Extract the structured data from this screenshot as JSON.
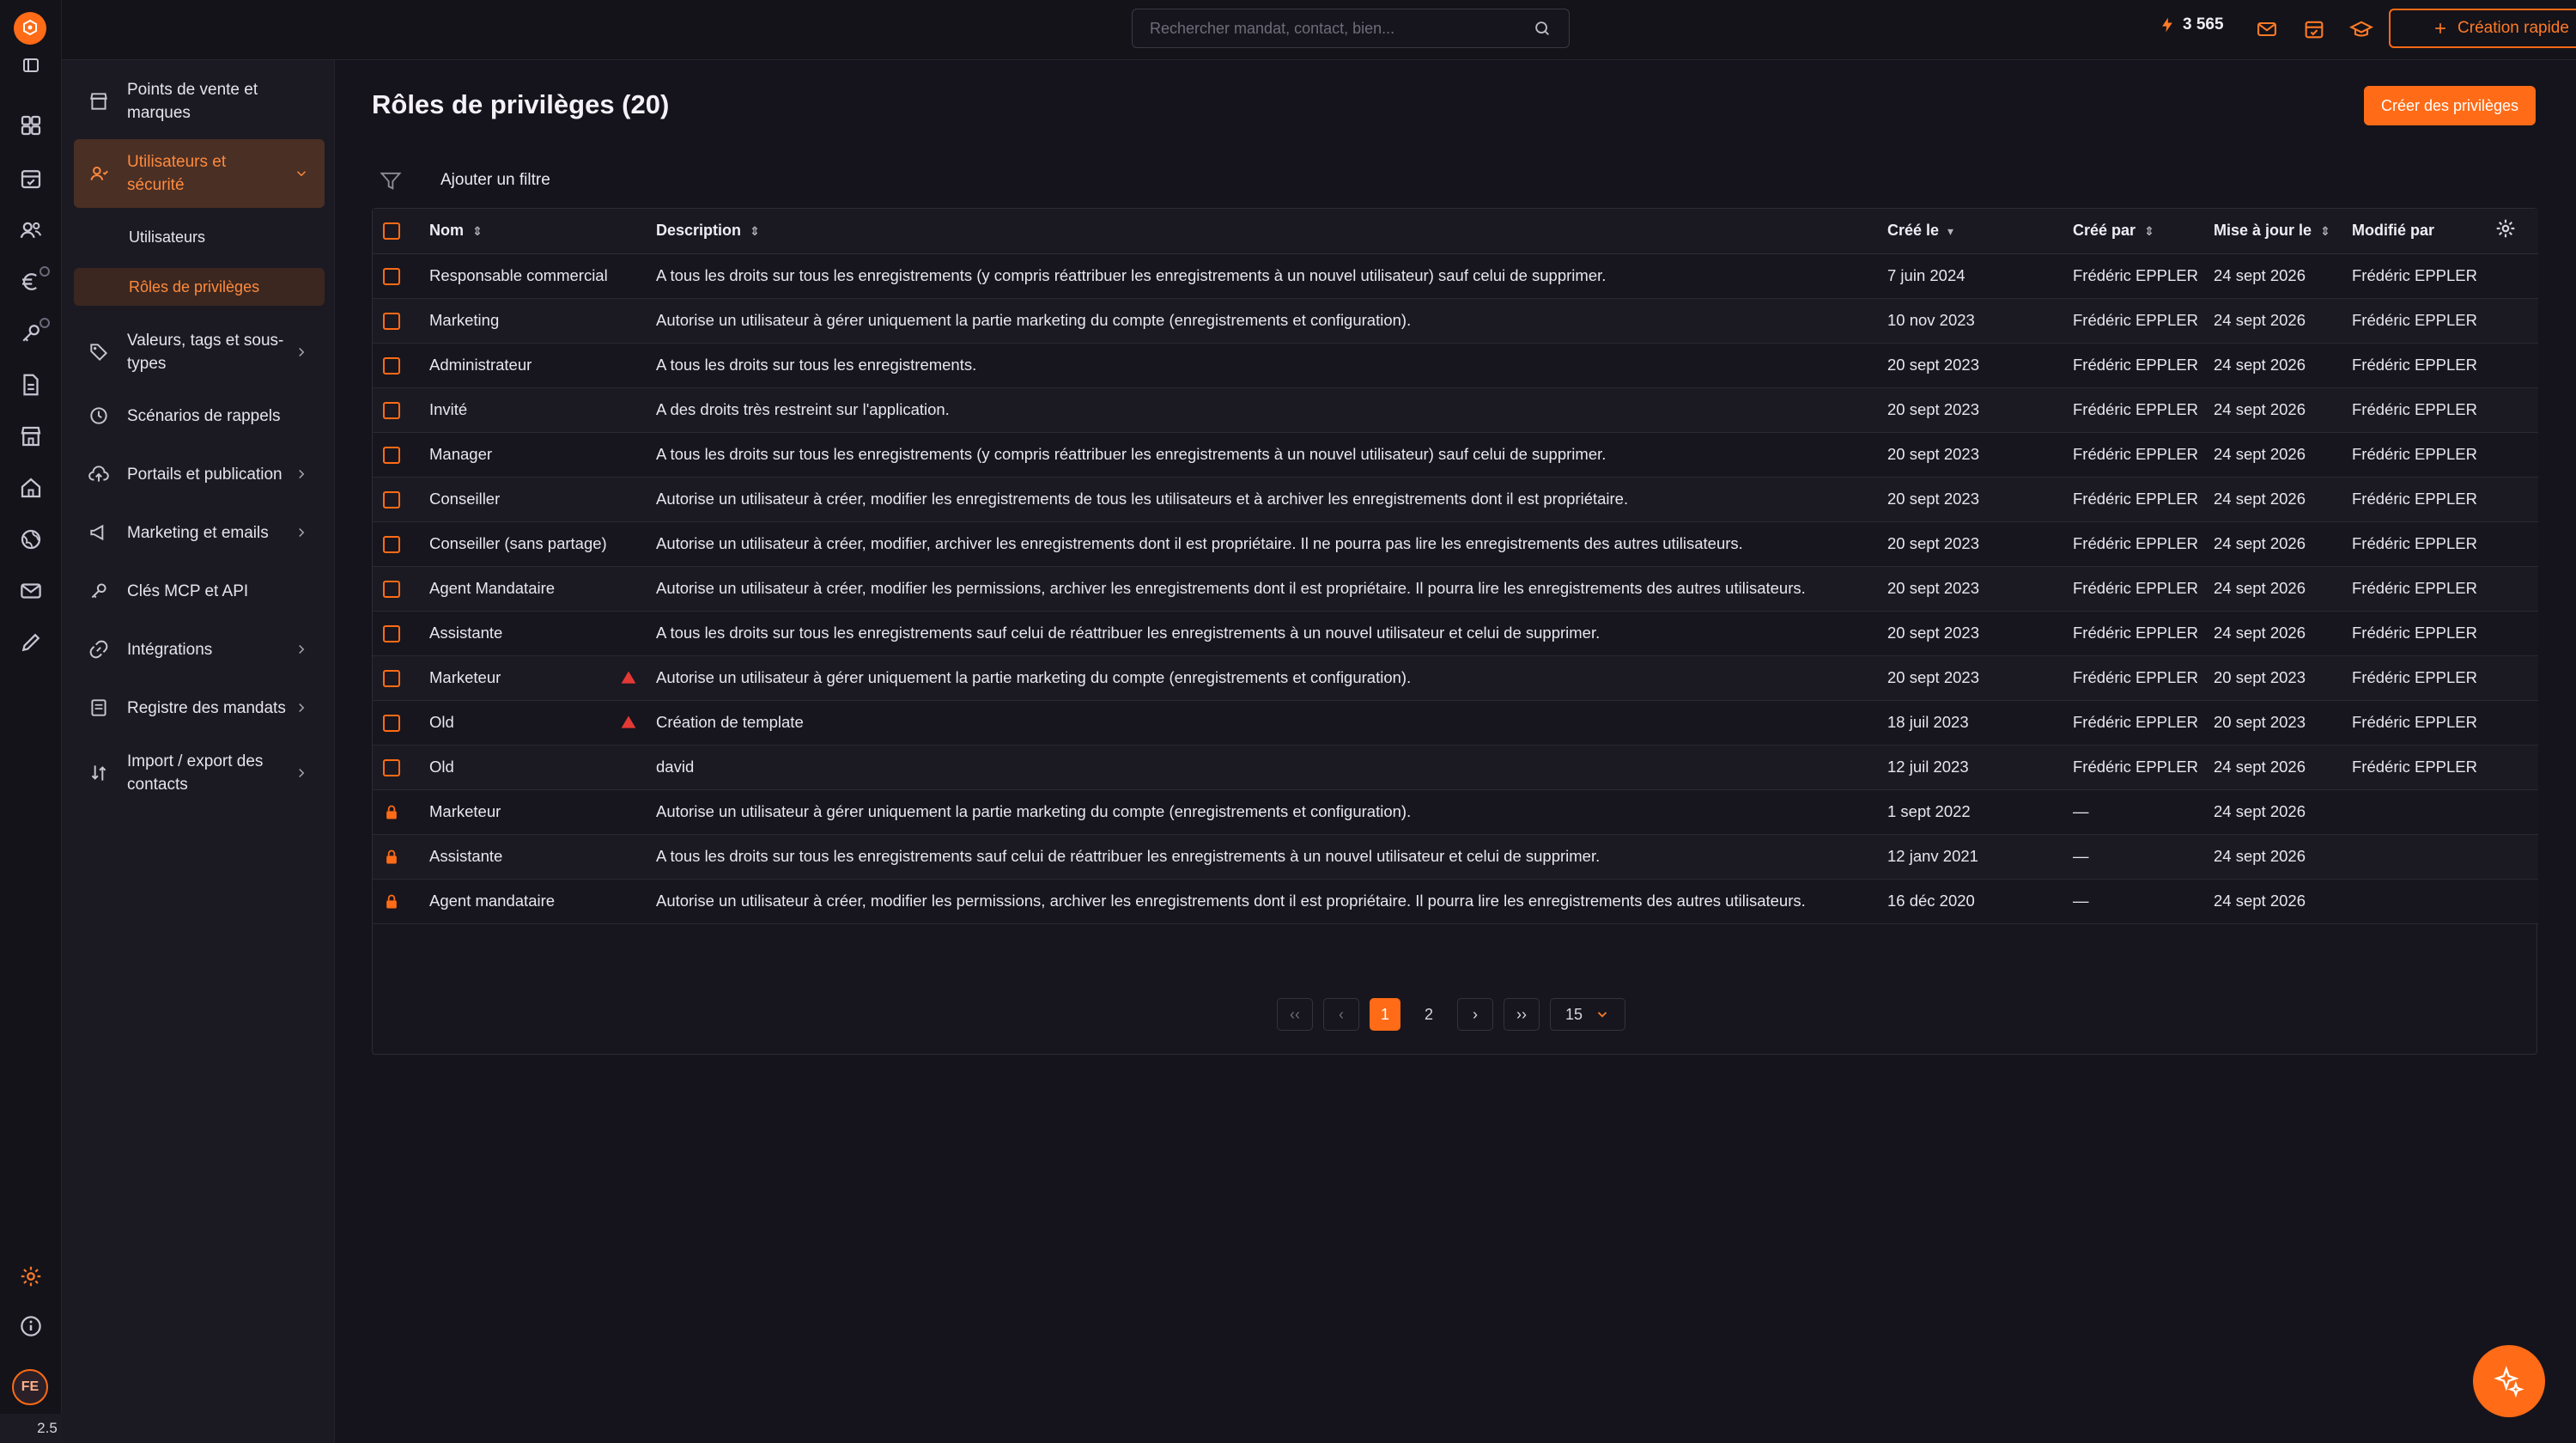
{
  "topbar": {
    "search_placeholder": "Rechercher mandat, contact, bien...",
    "credits": "3 565",
    "quick_create_label": "Création rapide"
  },
  "rail": {
    "version": "2.5",
    "avatar_initials": "FE"
  },
  "sidebar": {
    "items": [
      {
        "label": "Points de vente et marques",
        "icon": "store-icon"
      },
      {
        "label": "Utilisateurs et sécurité",
        "icon": "users-icon"
      },
      {
        "label": "Valeurs, tags et sous-types",
        "icon": "tag-icon"
      },
      {
        "label": "Scénarios de rappels",
        "icon": "clock-icon"
      },
      {
        "label": "Portails et publication",
        "icon": "cloud-upload-icon"
      },
      {
        "label": "Marketing et emails",
        "icon": "megaphone-icon"
      },
      {
        "label": "Clés MCP et API",
        "icon": "key-icon"
      },
      {
        "label": "Intégrations",
        "icon": "link-icon"
      },
      {
        "label": "Registre des mandats",
        "icon": "register-icon"
      },
      {
        "label": "Import / export des contacts",
        "icon": "import-export-icon"
      }
    ],
    "subitems": [
      {
        "label": "Utilisateurs"
      },
      {
        "label": "Rôles de privilèges"
      }
    ]
  },
  "main": {
    "title": "Rôles de privilèges (20)",
    "create_button": "Créer des privilèges",
    "filter_label": "Ajouter un filtre"
  },
  "table": {
    "columns": {
      "name": "Nom",
      "description": "Description",
      "created_on": "Créé le",
      "created_by": "Créé par",
      "updated_on": "Mise à jour le",
      "modified_by": "Modifié par"
    },
    "rows": [
      {
        "name": "Responsable commercial",
        "description": "A tous les droits sur tous les enregistrements (y compris réattribuer les enregistrements à un nouvel utilisateur) sauf celui de supprimer.",
        "created_on": "7 juin 2024",
        "created_by": "Frédéric EPPLER",
        "updated_on": "24 sept 2026",
        "modified_by": "Frédéric EPPLER"
      },
      {
        "name": "Marketing",
        "description": "Autorise un utilisateur à gérer uniquement la partie marketing du compte (enregistrements et configuration).",
        "created_on": "10 nov 2023",
        "created_by": "Frédéric EPPLER",
        "updated_on": "24 sept 2026",
        "modified_by": "Frédéric EPPLER"
      },
      {
        "name": "Administrateur",
        "description": "A tous les droits sur tous les enregistrements.",
        "created_on": "20 sept 2023",
        "created_by": "Frédéric EPPLER",
        "updated_on": "24 sept 2026",
        "modified_by": "Frédéric EPPLER"
      },
      {
        "name": "Invité",
        "description": "A des droits très restreint sur l'application.",
        "created_on": "20 sept 2023",
        "created_by": "Frédéric EPPLER",
        "updated_on": "24 sept 2026",
        "modified_by": "Frédéric EPPLER"
      },
      {
        "name": "Manager",
        "description": "A tous les droits sur tous les enregistrements (y compris réattribuer les enregistrements à un nouvel utilisateur) sauf celui de supprimer.",
        "created_on": "20 sept 2023",
        "created_by": "Frédéric EPPLER",
        "updated_on": "24 sept 2026",
        "modified_by": "Frédéric EPPLER"
      },
      {
        "name": "Conseiller",
        "description": "Autorise un utilisateur à créer, modifier les enregistrements de tous les utilisateurs et à archiver les enregistrements dont il est propriétaire.",
        "created_on": "20 sept 2023",
        "created_by": "Frédéric EPPLER",
        "updated_on": "24 sept 2026",
        "modified_by": "Frédéric EPPLER"
      },
      {
        "name": "Conseiller (sans partage)",
        "description": "Autorise un utilisateur à créer, modifier, archiver les enregistrements dont il est propriétaire. Il ne pourra pas lire les enregistrements des autres utilisateurs.",
        "created_on": "20 sept 2023",
        "created_by": "Frédéric EPPLER",
        "updated_on": "24 sept 2026",
        "modified_by": "Frédéric EPPLER"
      },
      {
        "name": "Agent Mandataire",
        "description": "Autorise un utilisateur à créer, modifier les permissions, archiver les enregistrements dont il est propriétaire. Il pourra lire les enregistrements des autres utilisateurs.",
        "created_on": "20 sept 2023",
        "created_by": "Frédéric EPPLER",
        "updated_on": "24 sept 2026",
        "modified_by": "Frédéric EPPLER"
      },
      {
        "name": "Assistante",
        "description": "A tous les droits sur tous les enregistrements sauf celui de réattribuer les enregistrements à un nouvel utilisateur et celui de supprimer.",
        "created_on": "20 sept 2023",
        "created_by": "Frédéric EPPLER",
        "updated_on": "24 sept 2026",
        "modified_by": "Frédéric EPPLER"
      },
      {
        "name": "Marketeur",
        "warning": true,
        "description": "Autorise un utilisateur à gérer uniquement la partie marketing du compte (enregistrements et configuration).",
        "created_on": "20 sept 2023",
        "created_by": "Frédéric EPPLER",
        "updated_on": "20 sept 2023",
        "modified_by": "Frédéric EPPLER"
      },
      {
        "name": "Old",
        "warning": true,
        "description": "Création de template",
        "created_on": "18 juil 2023",
        "created_by": "Frédéric EPPLER",
        "updated_on": "20 sept 2023",
        "modified_by": "Frédéric EPPLER"
      },
      {
        "name": "Old",
        "description": "david",
        "created_on": "12 juil 2023",
        "created_by": "Frédéric EPPLER",
        "updated_on": "24 sept 2026",
        "modified_by": "Frédéric EPPLER"
      },
      {
        "name": "Marketeur",
        "locked": true,
        "description": "Autorise un utilisateur à gérer uniquement la partie marketing du compte (enregistrements et configuration).",
        "created_on": "1 sept 2022",
        "created_by": "—",
        "updated_on": "24 sept 2026",
        "modified_by": ""
      },
      {
        "name": "Assistante",
        "locked": true,
        "description": "A tous les droits sur tous les enregistrements sauf celui de réattribuer les enregistrements à un nouvel utilisateur et celui de supprimer.",
        "created_on": "12 janv 2021",
        "created_by": "—",
        "updated_on": "24 sept 2026",
        "modified_by": ""
      },
      {
        "name": "Agent mandataire",
        "locked": true,
        "description": "Autorise un utilisateur à créer, modifier les permissions, archiver les enregistrements dont il est propriétaire. Il pourra lire les enregistrements des autres utilisateurs.",
        "created_on": "16 déc 2020",
        "created_by": "—",
        "updated_on": "24 sept 2026",
        "modified_by": ""
      }
    ]
  },
  "pagination": {
    "first": "‹‹",
    "prev": "‹",
    "page_1": "1",
    "page_2": "2",
    "next": "›",
    "last": "››",
    "page_size": "15"
  },
  "colors": {
    "accent": "#ff6b16",
    "background": "#15141c",
    "sidebar_active": "#4a2f25"
  }
}
